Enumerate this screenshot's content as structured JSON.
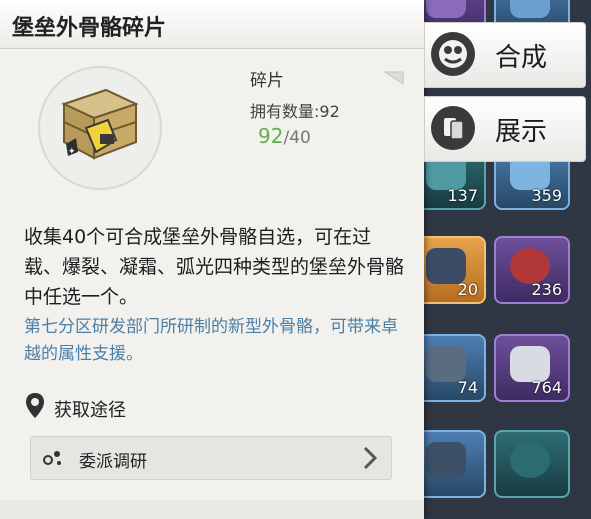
{
  "panel": {
    "title": "堡垒外骨骼碎片",
    "item_type": "碎片",
    "owned_label": "拥有数量:",
    "owned_count": "92",
    "progress_current": "92",
    "progress_sep": "/",
    "progress_required": "40",
    "description": "收集40个可合成堡垒外骨骼自选，可在过载、爆裂、凝霜、弧光四种类型的堡垒外骨骼中任选一个。",
    "lore": "第七分区研发部门所研制的新型外骨骼，可带来卓越的属性支援。",
    "acquire_label": "获取途径",
    "source_label": "委派调研"
  },
  "actions": {
    "combine_label": "合成",
    "show_label": "展示"
  },
  "inventory_counts": [
    "137",
    "359",
    "20",
    "236",
    "74",
    "764"
  ],
  "icons": {
    "combine": "combine-icon",
    "show": "showcase-icon",
    "location": "location-pin-icon",
    "source": "dispatch-icon",
    "chevron": "chevron-right-icon"
  },
  "colors": {
    "progress_ok": "#5fb24a",
    "lore_text": "#4b7fa6"
  }
}
